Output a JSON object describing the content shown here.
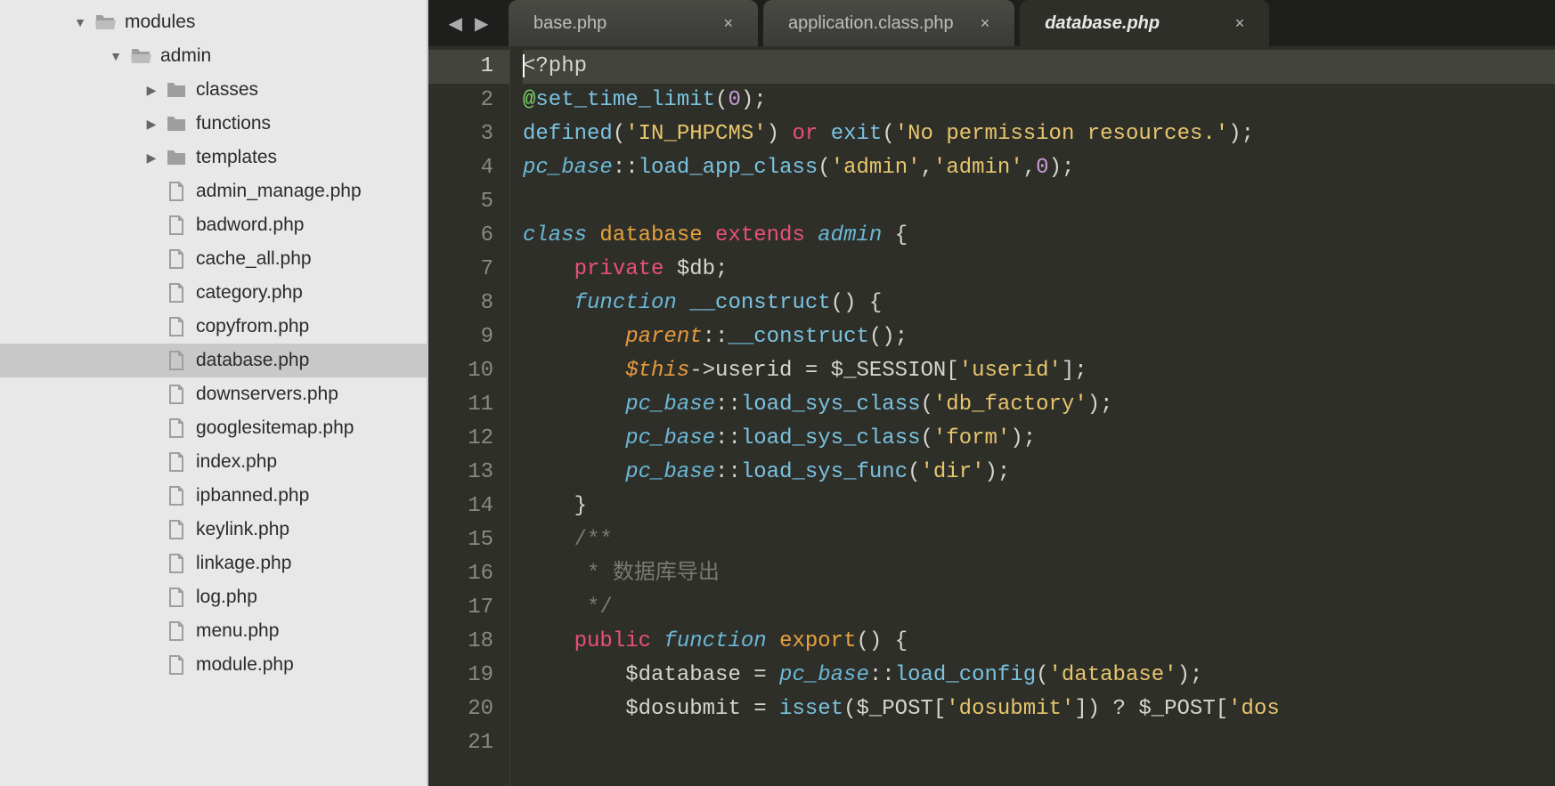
{
  "sidebar": {
    "tree": [
      {
        "level": 0,
        "kind": "folder-open",
        "arrow": "down",
        "label": "modules",
        "selected": false
      },
      {
        "level": 1,
        "kind": "folder-open",
        "arrow": "down",
        "label": "admin",
        "selected": false
      },
      {
        "level": 2,
        "kind": "folder",
        "arrow": "right",
        "label": "classes",
        "selected": false
      },
      {
        "level": 2,
        "kind": "folder",
        "arrow": "right",
        "label": "functions",
        "selected": false
      },
      {
        "level": 2,
        "kind": "folder",
        "arrow": "right",
        "label": "templates",
        "selected": false
      },
      {
        "level": 2,
        "kind": "file",
        "arrow": "",
        "label": "admin_manage.php",
        "selected": false
      },
      {
        "level": 2,
        "kind": "file",
        "arrow": "",
        "label": "badword.php",
        "selected": false
      },
      {
        "level": 2,
        "kind": "file",
        "arrow": "",
        "label": "cache_all.php",
        "selected": false
      },
      {
        "level": 2,
        "kind": "file",
        "arrow": "",
        "label": "category.php",
        "selected": false
      },
      {
        "level": 2,
        "kind": "file",
        "arrow": "",
        "label": "copyfrom.php",
        "selected": false
      },
      {
        "level": 2,
        "kind": "file",
        "arrow": "",
        "label": "database.php",
        "selected": true
      },
      {
        "level": 2,
        "kind": "file",
        "arrow": "",
        "label": "downservers.php",
        "selected": false
      },
      {
        "level": 2,
        "kind": "file",
        "arrow": "",
        "label": "googlesitemap.php",
        "selected": false
      },
      {
        "level": 2,
        "kind": "file",
        "arrow": "",
        "label": "index.php",
        "selected": false
      },
      {
        "level": 2,
        "kind": "file",
        "arrow": "",
        "label": "ipbanned.php",
        "selected": false
      },
      {
        "level": 2,
        "kind": "file",
        "arrow": "",
        "label": "keylink.php",
        "selected": false
      },
      {
        "level": 2,
        "kind": "file",
        "arrow": "",
        "label": "linkage.php",
        "selected": false
      },
      {
        "level": 2,
        "kind": "file",
        "arrow": "",
        "label": "log.php",
        "selected": false
      },
      {
        "level": 2,
        "kind": "file",
        "arrow": "",
        "label": "menu.php",
        "selected": false
      },
      {
        "level": 2,
        "kind": "file",
        "arrow": "",
        "label": "module.php",
        "selected": false
      }
    ]
  },
  "tabs": {
    "nav_prev": "◀",
    "nav_next": "▶",
    "items": [
      {
        "label": "base.php",
        "active": false
      },
      {
        "label": "application.class.php",
        "active": false
      },
      {
        "label": "database.php",
        "active": true
      }
    ],
    "close_glyph": "×"
  },
  "editor": {
    "line_start": 1,
    "line_count": 21,
    "current_line": 1,
    "code_lines": [
      [
        {
          "c": "tag",
          "t": "<?php",
          "cursor": true
        }
      ],
      [
        {
          "c": "err",
          "t": "@"
        },
        {
          "c": "func",
          "t": "set_time_limit"
        },
        {
          "c": "punc",
          "t": "("
        },
        {
          "c": "num",
          "t": "0"
        },
        {
          "c": "punc",
          "t": ");"
        }
      ],
      [
        {
          "c": "func",
          "t": "defined"
        },
        {
          "c": "punc",
          "t": "("
        },
        {
          "c": "str",
          "t": "'IN_PHPCMS'"
        },
        {
          "c": "punc",
          "t": ") "
        },
        {
          "c": "kw",
          "t": "or"
        },
        {
          "c": "punc",
          "t": " "
        },
        {
          "c": "func",
          "t": "exit"
        },
        {
          "c": "punc",
          "t": "("
        },
        {
          "c": "str",
          "t": "'No permission resources.'"
        },
        {
          "c": "punc",
          "t": ");"
        }
      ],
      [
        {
          "c": "type",
          "t": "pc_base"
        },
        {
          "c": "punc",
          "t": "::"
        },
        {
          "c": "call",
          "t": "load_app_class"
        },
        {
          "c": "punc",
          "t": "("
        },
        {
          "c": "str",
          "t": "'admin'"
        },
        {
          "c": "punc",
          "t": ","
        },
        {
          "c": "str",
          "t": "'admin'"
        },
        {
          "c": "punc",
          "t": ","
        },
        {
          "c": "num",
          "t": "0"
        },
        {
          "c": "punc",
          "t": ");"
        }
      ],
      [],
      [
        {
          "c": "kw2",
          "t": "class"
        },
        {
          "c": "punc",
          "t": " "
        },
        {
          "c": "name",
          "t": "database"
        },
        {
          "c": "punc",
          "t": " "
        },
        {
          "c": "kw",
          "t": "extends"
        },
        {
          "c": "punc",
          "t": " "
        },
        {
          "c": "type",
          "t": "admin"
        },
        {
          "c": "punc",
          "t": " {"
        }
      ],
      [
        {
          "c": "punc",
          "t": "    "
        },
        {
          "c": "kw",
          "t": "private"
        },
        {
          "c": "punc",
          "t": " $db;"
        }
      ],
      [
        {
          "c": "punc",
          "t": "    "
        },
        {
          "c": "kw2",
          "t": "function"
        },
        {
          "c": "punc",
          "t": " "
        },
        {
          "c": "call",
          "t": "__construct"
        },
        {
          "c": "punc",
          "t": "() {"
        }
      ],
      [
        {
          "c": "punc",
          "t": "        "
        },
        {
          "c": "imp",
          "t": "parent",
          "i": true
        },
        {
          "c": "punc",
          "t": "::"
        },
        {
          "c": "call",
          "t": "__construct"
        },
        {
          "c": "punc",
          "t": "();"
        }
      ],
      [
        {
          "c": "punc",
          "t": "        "
        },
        {
          "c": "imp",
          "t": "$this",
          "i": true
        },
        {
          "c": "punc",
          "t": "->userid = $_SESSION["
        },
        {
          "c": "str",
          "t": "'userid'"
        },
        {
          "c": "punc",
          "t": "];"
        }
      ],
      [
        {
          "c": "punc",
          "t": "        "
        },
        {
          "c": "type",
          "t": "pc_base"
        },
        {
          "c": "punc",
          "t": "::"
        },
        {
          "c": "call",
          "t": "load_sys_class"
        },
        {
          "c": "punc",
          "t": "("
        },
        {
          "c": "str",
          "t": "'db_factory'"
        },
        {
          "c": "punc",
          "t": ");"
        }
      ],
      [
        {
          "c": "punc",
          "t": "        "
        },
        {
          "c": "type",
          "t": "pc_base"
        },
        {
          "c": "punc",
          "t": "::"
        },
        {
          "c": "call",
          "t": "load_sys_class"
        },
        {
          "c": "punc",
          "t": "("
        },
        {
          "c": "str",
          "t": "'form'"
        },
        {
          "c": "punc",
          "t": ");"
        }
      ],
      [
        {
          "c": "punc",
          "t": "        "
        },
        {
          "c": "type",
          "t": "pc_base"
        },
        {
          "c": "punc",
          "t": "::"
        },
        {
          "c": "call",
          "t": "load_sys_func"
        },
        {
          "c": "punc",
          "t": "("
        },
        {
          "c": "str",
          "t": "'dir'"
        },
        {
          "c": "punc",
          "t": ");"
        }
      ],
      [
        {
          "c": "punc",
          "t": "    }"
        }
      ],
      [
        {
          "c": "punc",
          "t": "    "
        },
        {
          "c": "com",
          "t": "/**"
        }
      ],
      [
        {
          "c": "punc",
          "t": "    "
        },
        {
          "c": "com",
          "t": " * 数据库导出"
        }
      ],
      [
        {
          "c": "punc",
          "t": "    "
        },
        {
          "c": "com",
          "t": " */"
        }
      ],
      [
        {
          "c": "punc",
          "t": "    "
        },
        {
          "c": "kw",
          "t": "public"
        },
        {
          "c": "punc",
          "t": " "
        },
        {
          "c": "kw2",
          "t": "function"
        },
        {
          "c": "punc",
          "t": " "
        },
        {
          "c": "name",
          "t": "export"
        },
        {
          "c": "punc",
          "t": "() {"
        }
      ],
      [
        {
          "c": "punc",
          "t": "        $database = "
        },
        {
          "c": "type",
          "t": "pc_base"
        },
        {
          "c": "punc",
          "t": "::"
        },
        {
          "c": "call",
          "t": "load_config"
        },
        {
          "c": "punc",
          "t": "("
        },
        {
          "c": "str",
          "t": "'database'"
        },
        {
          "c": "punc",
          "t": ");"
        }
      ],
      [
        {
          "c": "punc",
          "t": "        $dosubmit = "
        },
        {
          "c": "call",
          "t": "isset"
        },
        {
          "c": "punc",
          "t": "($_POST["
        },
        {
          "c": "str",
          "t": "'dosubmit'"
        },
        {
          "c": "punc",
          "t": "]) ? $_POST["
        },
        {
          "c": "str",
          "t": "'dos"
        }
      ]
    ]
  }
}
